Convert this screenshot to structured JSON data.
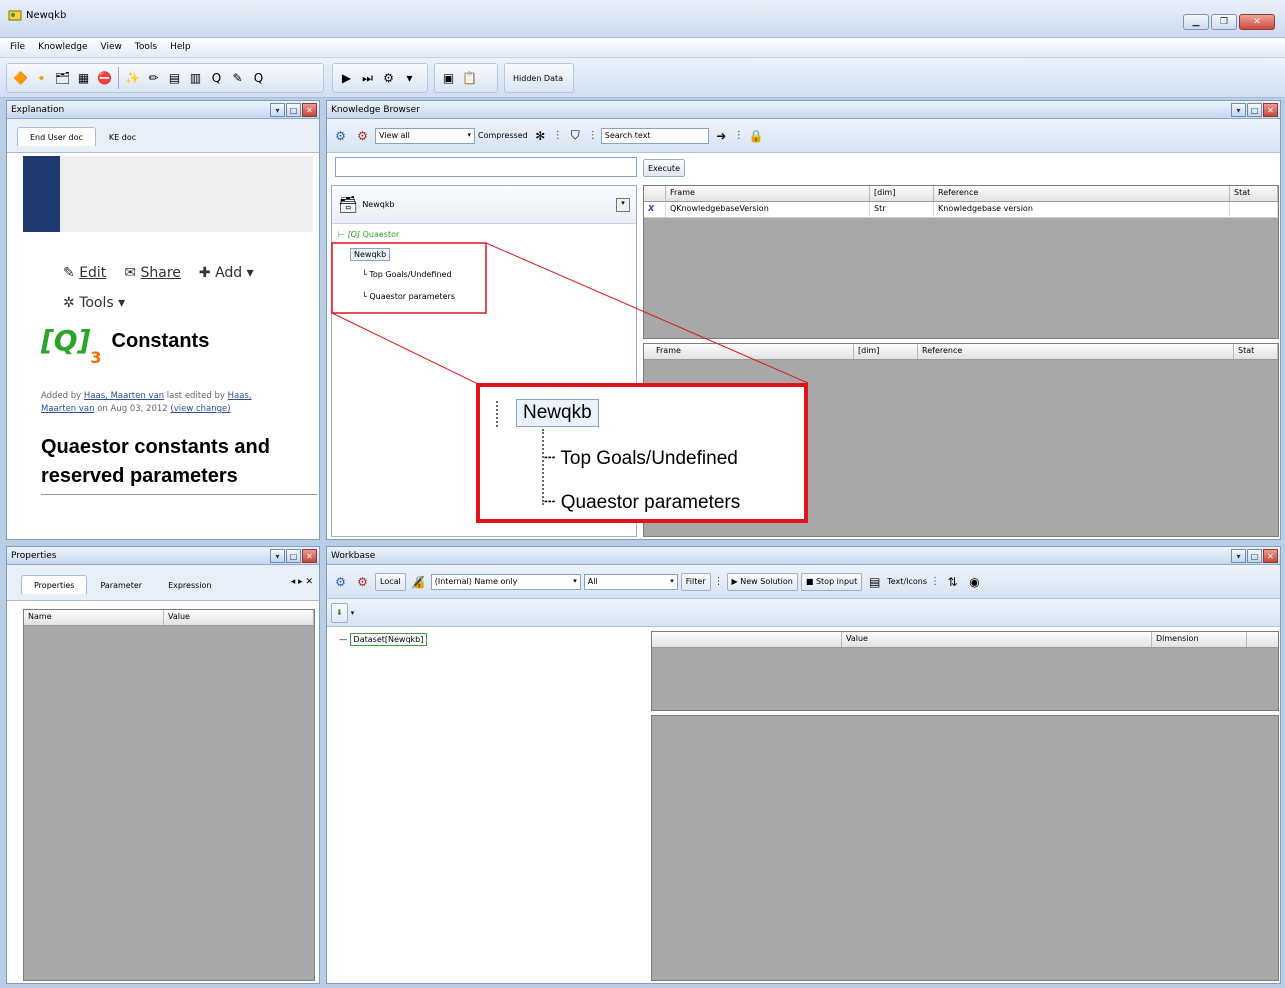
{
  "window": {
    "title": "Newqkb"
  },
  "menu": [
    "File",
    "Knowledge",
    "View",
    "Tools",
    "Help"
  ],
  "toolbar": {
    "hidden_data_label": "Hidden Data"
  },
  "explanation": {
    "title": "Explanation",
    "tabs": [
      "End User doc",
      "KE doc"
    ],
    "actions": {
      "edit": "Edit",
      "share": "Share",
      "add": "Add",
      "tools": "Tools"
    },
    "page_title": "Constants",
    "logo_sub": "3",
    "meta_line1_pre": "Added by ",
    "meta_author": "Haas, Maarten van",
    "meta_mid": " last edited by ",
    "meta_author2a": "Haas,",
    "meta_author2b": "Maarten van",
    "meta_on": " on Aug 03, 2012 ",
    "meta_view": "(view change)",
    "heading_line1": "Quaestor constants and",
    "heading_line2": "reserved parameters"
  },
  "properties": {
    "title": "Properties",
    "tabs": [
      "Properties",
      "Parameter",
      "Expression"
    ],
    "columns": [
      "Name",
      "Value"
    ]
  },
  "kb": {
    "title": "Knowledge Browser",
    "view_option": "View all",
    "compressed_label": "Compressed",
    "search_placeholder": "Search text",
    "execute_label": "Execute",
    "tree_root": "Newqkb",
    "tree_items": {
      "quaestor": "Quaestor",
      "newqkb": "Newqkb",
      "top_goals": "Top Goals/Undefined",
      "params": "Quaestor parameters"
    },
    "grid1": {
      "columns": [
        "Frame",
        "[dim]",
        "Reference",
        "Stat"
      ],
      "rows": [
        {
          "frame": "QKnowledgebaseVersion",
          "dim": "Str",
          "ref": "Knowledgebase version",
          "stat": ""
        }
      ]
    },
    "grid2": {
      "columns": [
        "Frame",
        "[dim]",
        "Reference",
        "Stat"
      ]
    },
    "zoom": {
      "newqkb": "Newqkb",
      "top_goals": "Top Goals/Undefined",
      "params": "Quaestor parameters"
    }
  },
  "workbase": {
    "title": "Workbase",
    "local_label": "Local",
    "name_option": "(Internal) Name only",
    "all_option": "All",
    "filter_label": "Filter",
    "new_solution_label": "New Solution",
    "stop_input_label": "Stop input",
    "text_icons_label": "Text/Icons",
    "tree_item": "Dataset[Newqkb]",
    "grid": {
      "columns": [
        "",
        "Value",
        "Dimension"
      ]
    }
  },
  "colors": {
    "accent": "#1f3a6e",
    "logo_green": "#2aa52a",
    "logo_orange": "#ff6a00",
    "highlight_red": "#e1141c"
  }
}
